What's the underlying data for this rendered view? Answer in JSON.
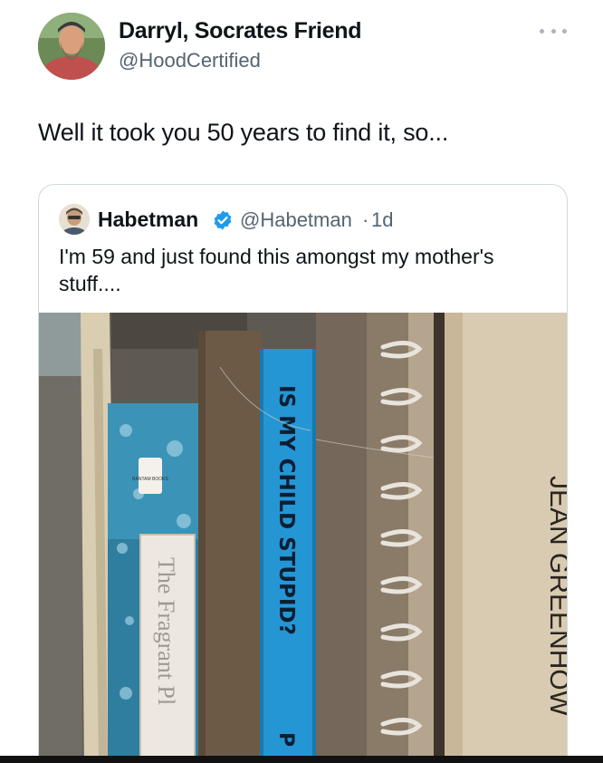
{
  "tweet": {
    "author_name": "Darryl, Socrates Friend",
    "author_handle": "@HoodCertified",
    "text": "Well it took you 50 years to find it, so..."
  },
  "quoted_tweet": {
    "author_name": "Habetman",
    "author_handle": "@Habetman",
    "separator": "·",
    "time": "1d",
    "text": "I'm 59 and just found this amongst my mother's stuff....",
    "photo": {
      "book_spine_blue": "IS MY CHILD STUPID?",
      "book_spine_blue_partial": "P",
      "book_right_spine": "JEAN GREENHOW",
      "book_left_title": "The Fragrant Pl",
      "book_left_publisher": "BANTAM BOOKS"
    }
  },
  "icons": {
    "more": "more-horizontal-icon",
    "verified": "verified-badge-icon"
  },
  "colors": {
    "text": "#0f1419",
    "secondary": "#536471",
    "border": "#cfd9de",
    "verified": "#1d9bf0"
  }
}
